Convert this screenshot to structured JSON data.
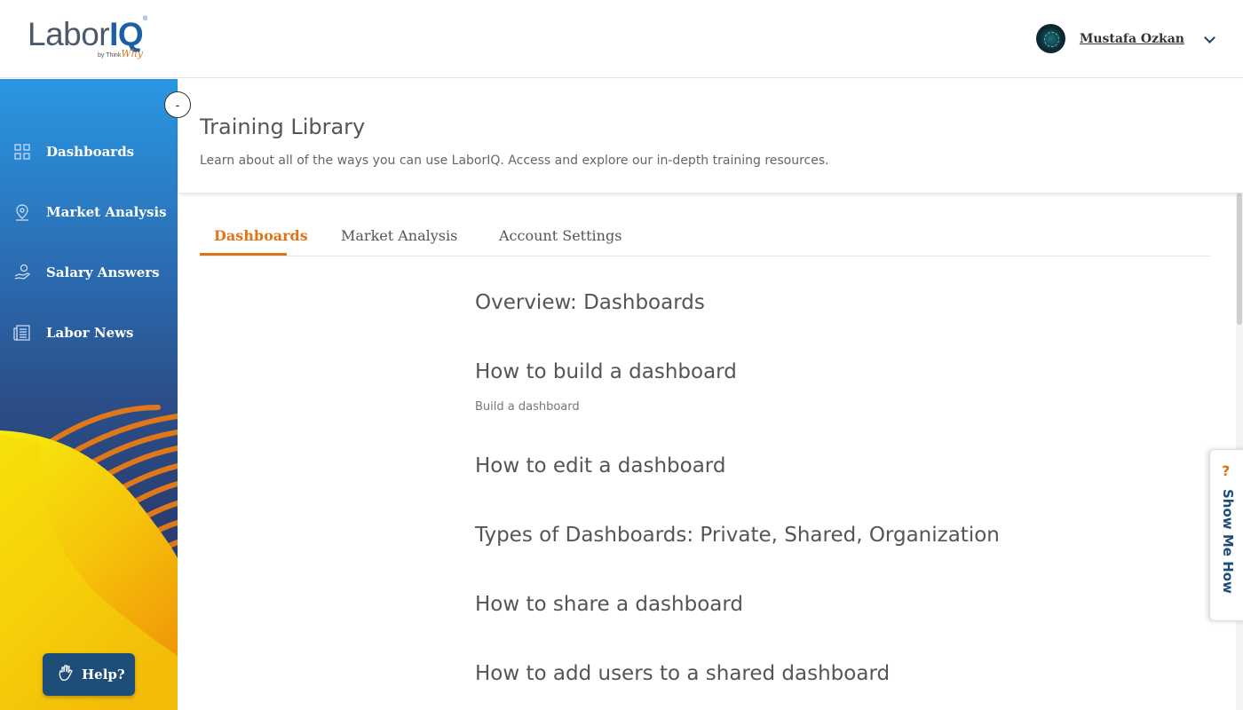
{
  "header": {
    "logo": {
      "labor": "Labor",
      "iq": "IQ",
      "by": "by Think",
      "why": "Why",
      "tm": "®"
    },
    "user": {
      "name": "Mustafa Ozkan",
      "avatar_icon": "avatar-icon",
      "menu_icon": "chevron-down-icon"
    }
  },
  "sidebar": {
    "collapse_label": "-",
    "items": [
      {
        "label": "Dashboards",
        "icon": "grid-icon"
      },
      {
        "label": "Market Analysis",
        "icon": "map-pin-icon"
      },
      {
        "label": "Salary Answers",
        "icon": "hand-coin-icon"
      },
      {
        "label": "Labor News",
        "icon": "newspaper-icon"
      }
    ],
    "help": {
      "label": "Help?",
      "icon": "hand-wave-icon"
    },
    "colors": {
      "top": "#2a97e3",
      "bottom": "#2a3e72",
      "accent_orange": "#e07416",
      "accent_yellow": "#f5e10a"
    }
  },
  "page": {
    "title": "Training Library",
    "subtitle": "Learn about all of the ways you can use LaborIQ. Access and explore our in-depth training resources."
  },
  "tabs": [
    {
      "label": "Dashboards",
      "active": true
    },
    {
      "label": "Market Analysis",
      "active": false
    },
    {
      "label": "Account Settings",
      "active": false
    }
  ],
  "lessons": [
    {
      "title": "Overview: Dashboards",
      "subtitle": ""
    },
    {
      "title": "How to build a dashboard",
      "subtitle": "Build a dashboard"
    },
    {
      "title": "How to edit a dashboard",
      "subtitle": ""
    },
    {
      "title": "Types of Dashboards: Private, Shared, Organization",
      "subtitle": ""
    },
    {
      "title": "How to share a dashboard",
      "subtitle": ""
    },
    {
      "title": "How to add users to a shared dashboard",
      "subtitle": ""
    }
  ],
  "show_me_how": {
    "icon_label": "?",
    "label": "Show Me How"
  }
}
